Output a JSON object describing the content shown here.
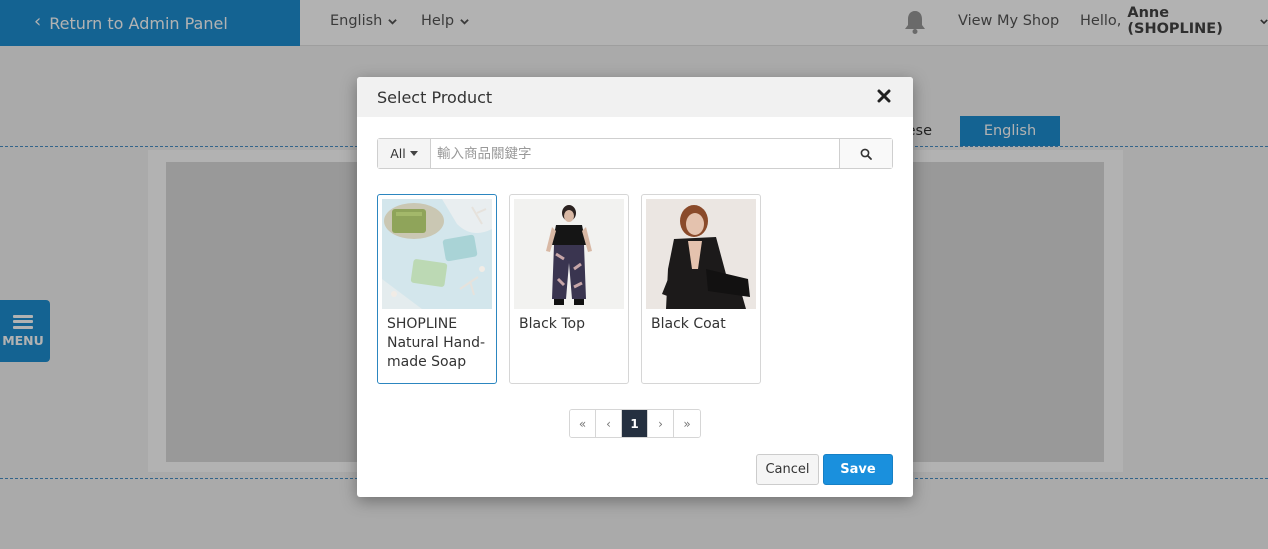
{
  "topbar": {
    "return_label": "Return to Admin Panel",
    "language_label": "English",
    "help_label": "Help",
    "view_shop_label": "View My Shop",
    "hello_prefix": "Hello,",
    "hello_user": "Anne (SHOPLINE)"
  },
  "background": {
    "lang_tab_partial": "ese",
    "lang_tab_active": "English",
    "menu_label": "MENU"
  },
  "modal": {
    "title": "Select Product",
    "filter_label": "All",
    "search_placeholder": "輸入商品關鍵字",
    "products": [
      {
        "name": "SHOPLINE Natural Hand-made Soap",
        "selected": true
      },
      {
        "name": "Black Top",
        "selected": false
      },
      {
        "name": "Black Coat",
        "selected": false
      }
    ],
    "pagination": {
      "first": "«",
      "prev": "‹",
      "current": "1",
      "next": "›",
      "last": "»"
    },
    "cancel_label": "Cancel",
    "save_label": "Save"
  },
  "colors": {
    "accent": "#1d8fd2",
    "pager_active": "#253040",
    "selected_border": "#2c86c0"
  }
}
